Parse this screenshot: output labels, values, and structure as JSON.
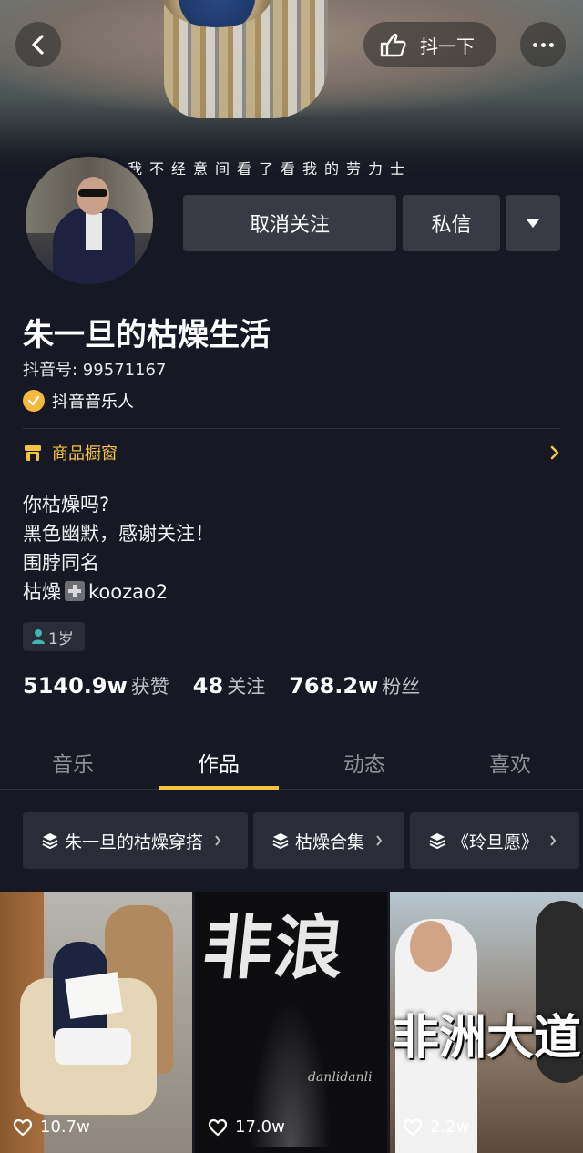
{
  "header": {
    "cover_caption": "我不经意间看了看我的劳力士",
    "shake_label": "抖一下"
  },
  "actions": {
    "unfollow": "取消关注",
    "message": "私信"
  },
  "profile": {
    "name": "朱一旦的枯燥生活",
    "douyin_id": "抖音号: 99571167",
    "verified_label": "抖音音乐人",
    "shop_label": "商品橱窗",
    "bio": [
      "你枯燥吗?",
      "黑色幽默，感谢关注！",
      "围脖同名",
      "枯燥",
      "koozao2"
    ],
    "age": "1岁"
  },
  "stats": {
    "likes_num": "5140.9w",
    "likes_label": "获赞",
    "following_num": "48",
    "following_label": "关注",
    "followers_num": "768.2w",
    "followers_label": "粉丝"
  },
  "tabs": [
    "音乐",
    "作品",
    "动态",
    "喜欢"
  ],
  "active_tab": "作品",
  "collections": [
    "朱一旦的枯燥穿搭",
    "枯燥合集",
    "《玲旦愿》"
  ],
  "videos": [
    {
      "likes": "10.7w"
    },
    {
      "likes": "17.0w",
      "title": "非浪",
      "signature": "danlidanli"
    },
    {
      "likes": "2.2w",
      "title": "非洲大道"
    }
  ],
  "colors": {
    "background": "#161823",
    "accent_yellow": "#f5c342",
    "button_gray": "#393b44",
    "verified_orange": "#f5b83d"
  },
  "icons": [
    "back-arrow-icon",
    "hand-shake-icon",
    "more-dots-icon",
    "dropdown-triangle-icon",
    "verified-check-icon",
    "shop-icon",
    "chevron-right-icon",
    "person-icon",
    "stack-icon",
    "heart-icon"
  ]
}
